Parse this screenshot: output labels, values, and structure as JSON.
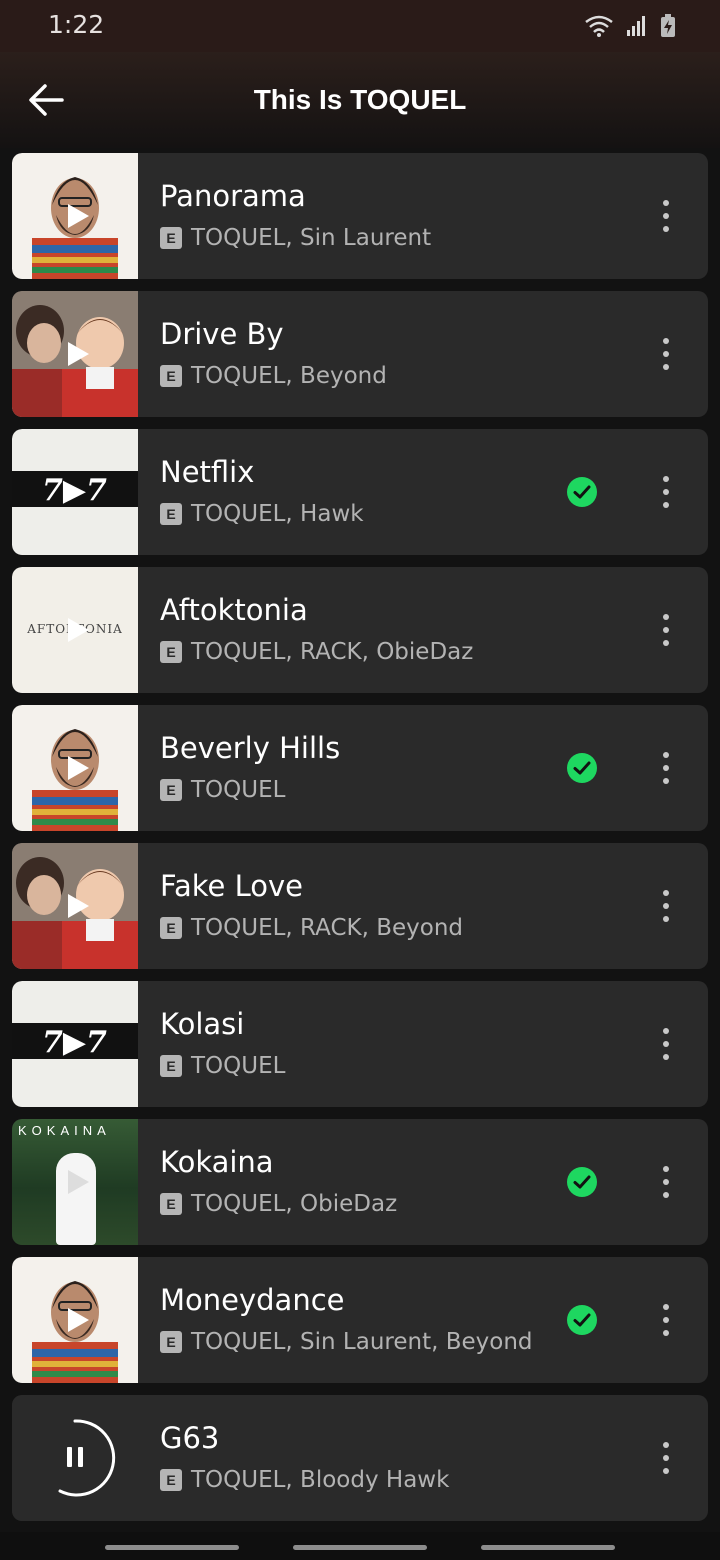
{
  "status_bar": {
    "time": "1:22"
  },
  "header": {
    "title": "This Is TOQUEL"
  },
  "colors": {
    "accent_green": "#1ed760",
    "background": "#121212",
    "row": "#2a2a2a"
  },
  "tracks": [
    {
      "title": "Panorama",
      "explicit": "E",
      "artists": "TOQUEL, Sin Laurent",
      "downloaded": false,
      "art": "portrait"
    },
    {
      "title": "Drive By",
      "explicit": "E",
      "artists": "TOQUEL, Beyond",
      "downloaded": false,
      "art": "photo"
    },
    {
      "title": "Netflix",
      "explicit": "E",
      "artists": "TOQUEL, Hawk",
      "downloaded": true,
      "art": "777"
    },
    {
      "title": "Aftoktonia",
      "explicit": "E",
      "artists": "TOQUEL, RACK, ObieDaz",
      "downloaded": false,
      "art": "white"
    },
    {
      "title": "Beverly Hills",
      "explicit": "E",
      "artists": "TOQUEL",
      "downloaded": true,
      "art": "portrait"
    },
    {
      "title": "Fake Love",
      "explicit": "E",
      "artists": "TOQUEL, RACK, Beyond",
      "downloaded": false,
      "art": "photo"
    },
    {
      "title": "Kolasi",
      "explicit": "E",
      "artists": "TOQUEL",
      "downloaded": false,
      "art": "777"
    },
    {
      "title": "Kokaina",
      "explicit": "E",
      "artists": "TOQUEL, ObieDaz",
      "downloaded": true,
      "art": "jungle"
    },
    {
      "title": "Moneydance",
      "explicit": "E",
      "artists": "TOQUEL, Sin Laurent, Beyond",
      "downloaded": true,
      "art": "portrait"
    },
    {
      "title": "G63",
      "explicit": "E",
      "artists": "TOQUEL, Bloody Hawk",
      "downloaded": false,
      "art": "playing"
    }
  ],
  "art_text": {
    "777": "7▶7",
    "aftoktonia": "AFTOKTONIA",
    "kokaina": "KOKAINA"
  }
}
